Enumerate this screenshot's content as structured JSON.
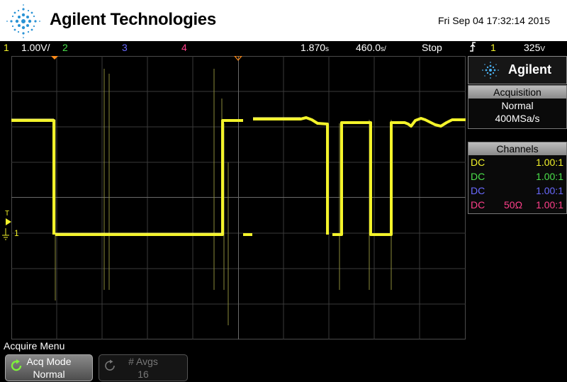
{
  "header": {
    "brand": "Agilent Technologies",
    "datetime": "Fri Sep 04 17:32:14 2015"
  },
  "status_bar": {
    "ch1_num": "1",
    "ch1_scale": "1.00V/",
    "ch2_num": "2",
    "ch3_num": "3",
    "ch4_num": "4",
    "time_pos": "1.870",
    "time_pos_unit": "s",
    "time_scale": "460.0",
    "time_scale_unit": "s/",
    "run_state": "Stop",
    "trigger_channel": "1",
    "trigger_level": "325",
    "trigger_level_unit": "V",
    "colors": {
      "ch1": "#f3f32a",
      "ch2": "#4be04b",
      "ch3": "#6a6aff",
      "ch4": "#ff3f8a"
    }
  },
  "side_panel": {
    "logo_text": "Agilent",
    "acquisition": {
      "title": "Acquisition",
      "mode": "Normal",
      "rate": "400MSa/s"
    },
    "channels": {
      "title": "Channels",
      "rows": [
        {
          "coupling": "DC",
          "impedance": "",
          "probe": "1.00:1",
          "color": "#f3f32a"
        },
        {
          "coupling": "DC",
          "impedance": "",
          "probe": "1.00:1",
          "color": "#4be04b"
        },
        {
          "coupling": "DC",
          "impedance": "",
          "probe": "1.00:1",
          "color": "#6a6aff"
        },
        {
          "coupling": "DC",
          "impedance": "50Ω",
          "probe": "1.00:1",
          "color": "#ff3f8a"
        }
      ]
    }
  },
  "display": {
    "trigger_marker": "T",
    "ground_marker": "1"
  },
  "softkeys": {
    "menu_title": "Acquire Menu",
    "acq_mode_label": "Acq Mode",
    "acq_mode_value": "Normal",
    "avgs_label": "# Avgs",
    "avgs_value": "16"
  }
}
